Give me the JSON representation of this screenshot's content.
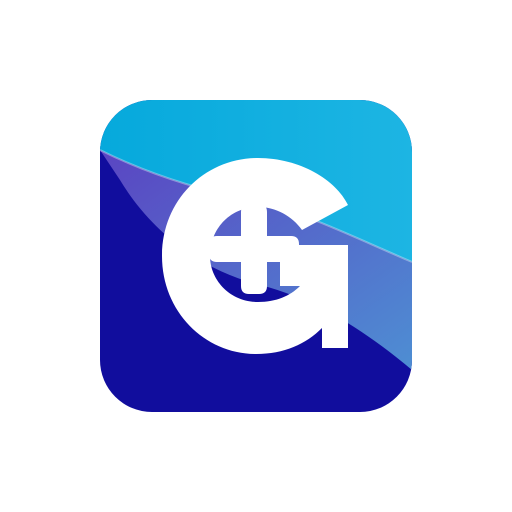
{
  "app_icon": {
    "name": "app-icon",
    "logo_letter": "G",
    "symbol": "plus",
    "colors": {
      "top_cyan": "#06A9DC",
      "top_cyan_light": "#1DB5E3",
      "base_navy": "#110D9D",
      "base_navy_dark": "#0E0B8F",
      "wave_purple": "#5A45C2",
      "wave_blue": "#4E8ED3",
      "glyph_white": "#FFFFFF",
      "background": "#FFFFFF"
    }
  }
}
